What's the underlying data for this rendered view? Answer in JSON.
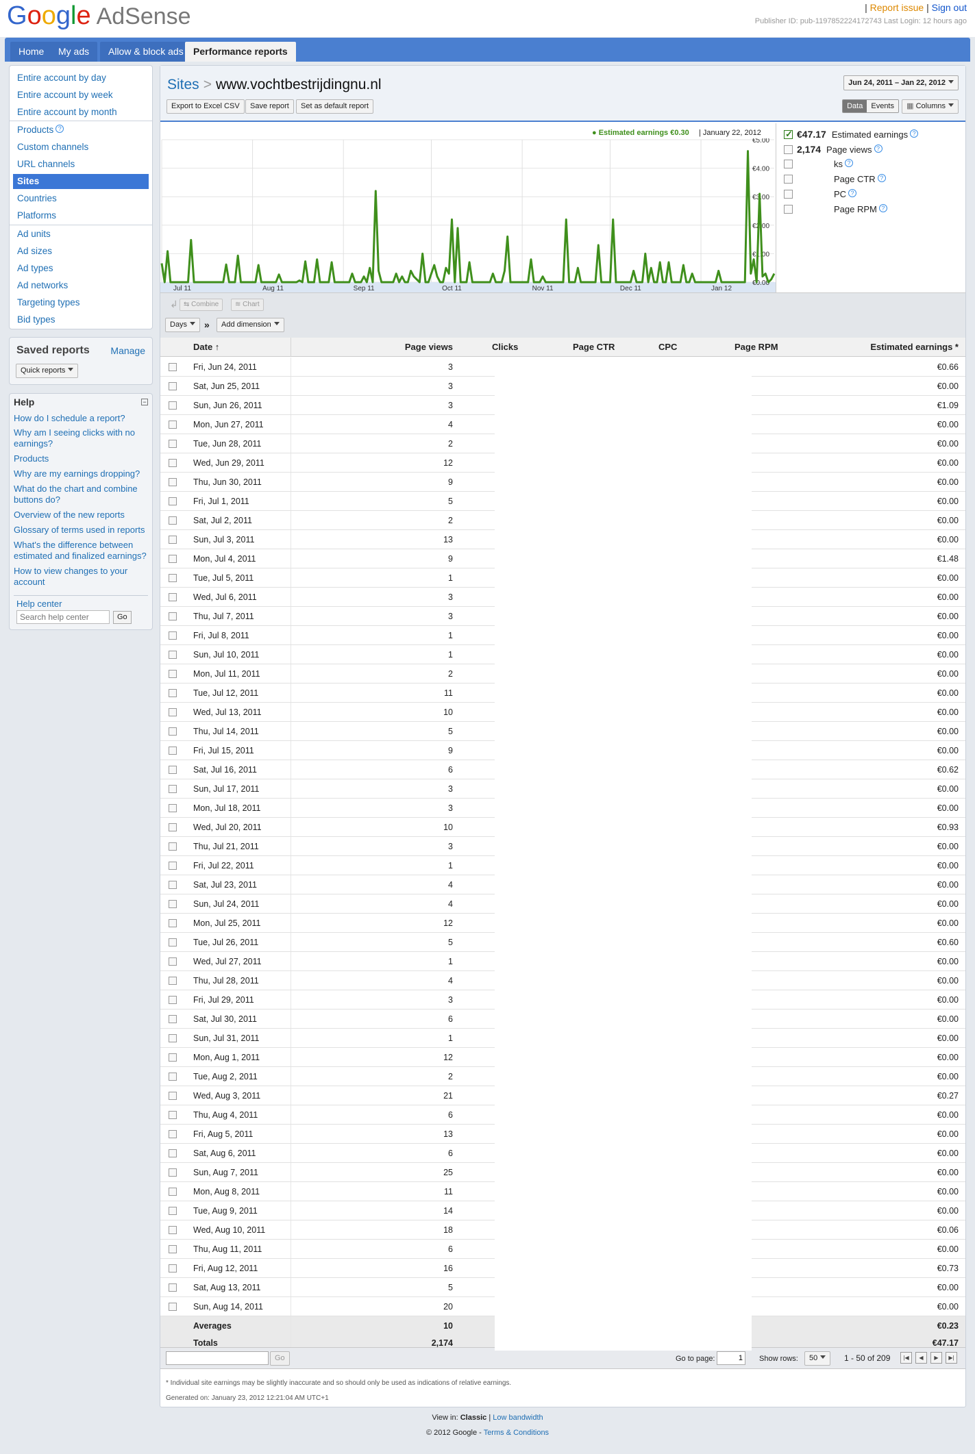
{
  "header": {
    "logo_letters": [
      "G",
      "o",
      "o",
      "g",
      "l",
      "e"
    ],
    "product": "AdSense",
    "report_issue": "Report issue",
    "sign_out": "Sign out",
    "publisher_info": "Publisher ID: pub-1197852224172743   Last Login: 12 hours ago"
  },
  "nav": [
    "Home",
    "My ads",
    "Allow & block ads",
    "Performance reports"
  ],
  "sidebar": {
    "items": [
      "Entire account by day",
      "Entire account by week",
      "Entire account by month",
      "Products",
      "Custom channels",
      "URL channels",
      "Sites",
      "Countries",
      "Platforms",
      "Ad units",
      "Ad sizes",
      "Ad types",
      "Ad networks",
      "Targeting types",
      "Bid types"
    ],
    "active_index": 6
  },
  "saved_reports": {
    "title": "Saved reports",
    "manage": "Manage",
    "quick": "Quick reports"
  },
  "help": {
    "title": "Help",
    "collapse": "−",
    "links": [
      "How do I schedule a report?",
      "Why am I seeing clicks with no earnings?",
      "Products",
      "Why are my earnings dropping?",
      "What do the chart and combine buttons do?",
      "Overview of the new reports",
      "Glossary of terms used in reports",
      "What's the difference between estimated and finalized earnings?",
      "How to view changes to your account"
    ],
    "help_center": "Help center",
    "search_placeholder": "Search help center",
    "go": "Go"
  },
  "report": {
    "crumb_parent": "Sites",
    "crumb_sep": ">",
    "crumb_current": "www.vochtbestrijdingnu.nl",
    "date_range": "Jun 24, 2011 – Jan 22, 2012",
    "btn_export": "Export to Excel CSV",
    "btn_save": "Save report",
    "btn_default": "Set as default report",
    "view_data": "Data",
    "view_events": "Events",
    "columns": "Columns",
    "combine": "Combine",
    "chart": "Chart",
    "days": "Days",
    "add_dimension": "Add dimension",
    "dim_sep": "»"
  },
  "metrics": [
    {
      "value": "€47.17",
      "label": "Estimated earnings",
      "checked": true
    },
    {
      "value": "2,174",
      "label": "Page views",
      "checked": false
    },
    {
      "value": "",
      "label": "ks",
      "checked": false
    },
    {
      "value": "",
      "label": "Page CTR",
      "checked": false
    },
    {
      "value": "",
      "label": "PC",
      "checked": false
    },
    {
      "value": "",
      "label": "Page RPM",
      "checked": false
    }
  ],
  "chart_data": {
    "type": "line",
    "tooltip_value": "● Estimated earnings €0.30",
    "tooltip_date": "January 22, 2012",
    "y_ticks": [
      "€5.00",
      "€4.00",
      "€3.00",
      "€2.00",
      "€1.00",
      "€0.00"
    ],
    "ylim": [
      0,
      5
    ],
    "x_ticks": [
      "Jul 11",
      "Aug 11",
      "Sep 11",
      "Oct 11",
      "Nov 11",
      "Dec 11",
      "Jan 12"
    ],
    "x_tick_days": [
      7,
      38,
      69,
      99,
      130,
      160,
      191
    ],
    "series_color": "#3f8f1c",
    "series": [
      {
        "values": [
          0.66,
          0,
          1.09,
          0,
          0,
          0,
          0,
          0,
          0,
          0,
          1.48,
          0,
          0,
          0,
          0,
          0,
          0,
          0,
          0,
          0,
          0,
          0,
          0.62,
          0,
          0,
          0,
          0.93,
          0,
          0,
          0,
          0,
          0,
          0,
          0.6,
          0,
          0,
          0,
          0,
          0,
          0,
          0.27,
          0,
          0,
          0,
          0,
          0,
          0,
          0.06,
          0,
          0.73,
          0,
          0,
          0,
          0.8,
          0,
          0,
          0,
          0,
          0.7,
          0,
          0,
          0,
          0,
          0,
          0,
          0.3,
          0,
          0,
          0,
          0.2,
          0,
          0.5,
          0,
          3.2,
          0.4,
          0,
          0,
          0,
          0,
          0,
          0.3,
          0,
          0.2,
          0,
          0,
          0.4,
          0.2,
          0.1,
          0,
          1.0,
          0,
          0,
          0.3,
          0.6,
          0.2,
          0,
          0,
          0.5,
          0.3,
          2.2,
          0,
          1.9,
          0,
          0,
          0,
          0.7,
          0,
          0,
          0,
          0,
          0,
          0,
          0,
          0.3,
          0,
          0,
          0,
          0.4,
          1.6,
          0,
          0,
          0,
          0,
          0,
          0,
          0,
          0.8,
          0,
          0,
          0,
          0.2,
          0,
          0,
          0,
          0,
          0,
          0,
          0,
          2.2,
          0,
          0,
          0,
          0.5,
          0,
          0,
          0,
          0,
          0,
          0,
          1.3,
          0,
          0,
          0,
          0,
          2.2,
          0,
          0,
          0,
          0,
          0,
          0,
          0.4,
          0,
          0,
          0,
          1.0,
          0,
          0.5,
          0,
          0,
          0.7,
          0,
          0,
          0.7,
          0,
          0,
          0,
          0,
          0.6,
          0,
          0,
          0.3,
          0,
          0,
          0,
          0,
          0,
          0,
          0,
          0,
          0.4,
          0,
          0,
          0,
          0,
          0,
          0,
          0,
          0,
          0,
          4.6,
          0.3,
          0.8,
          0,
          3.1,
          0.2,
          0.3,
          0,
          0.1,
          0.3
        ]
      }
    ]
  },
  "table": {
    "columns": [
      "Date ↑",
      "Page views",
      "Clicks",
      "Page CTR",
      "CPC",
      "Page RPM",
      "Estimated earnings *"
    ],
    "rows": [
      [
        "Fri, Jun 24, 2011",
        "3",
        "€0.66"
      ],
      [
        "Sat, Jun 25, 2011",
        "3",
        "€0.00"
      ],
      [
        "Sun, Jun 26, 2011",
        "3",
        "€1.09"
      ],
      [
        "Mon, Jun 27, 2011",
        "4",
        "€0.00"
      ],
      [
        "Tue, Jun 28, 2011",
        "2",
        "€0.00"
      ],
      [
        "Wed, Jun 29, 2011",
        "12",
        "€0.00"
      ],
      [
        "Thu, Jun 30, 2011",
        "9",
        "€0.00"
      ],
      [
        "Fri, Jul 1, 2011",
        "5",
        "€0.00"
      ],
      [
        "Sat, Jul 2, 2011",
        "2",
        "€0.00"
      ],
      [
        "Sun, Jul 3, 2011",
        "13",
        "€0.00"
      ],
      [
        "Mon, Jul 4, 2011",
        "9",
        "€1.48"
      ],
      [
        "Tue, Jul 5, 2011",
        "1",
        "€0.00"
      ],
      [
        "Wed, Jul 6, 2011",
        "3",
        "€0.00"
      ],
      [
        "Thu, Jul 7, 2011",
        "3",
        "€0.00"
      ],
      [
        "Fri, Jul 8, 2011",
        "1",
        "€0.00"
      ],
      [
        "Sun, Jul 10, 2011",
        "1",
        "€0.00"
      ],
      [
        "Mon, Jul 11, 2011",
        "2",
        "€0.00"
      ],
      [
        "Tue, Jul 12, 2011",
        "11",
        "€0.00"
      ],
      [
        "Wed, Jul 13, 2011",
        "10",
        "€0.00"
      ],
      [
        "Thu, Jul 14, 2011",
        "5",
        "€0.00"
      ],
      [
        "Fri, Jul 15, 2011",
        "9",
        "€0.00"
      ],
      [
        "Sat, Jul 16, 2011",
        "6",
        "€0.62"
      ],
      [
        "Sun, Jul 17, 2011",
        "3",
        "€0.00"
      ],
      [
        "Mon, Jul 18, 2011",
        "3",
        "€0.00"
      ],
      [
        "Wed, Jul 20, 2011",
        "10",
        "€0.93"
      ],
      [
        "Thu, Jul 21, 2011",
        "3",
        "€0.00"
      ],
      [
        "Fri, Jul 22, 2011",
        "1",
        "€0.00"
      ],
      [
        "Sat, Jul 23, 2011",
        "4",
        "€0.00"
      ],
      [
        "Sun, Jul 24, 2011",
        "4",
        "€0.00"
      ],
      [
        "Mon, Jul 25, 2011",
        "12",
        "€0.00"
      ],
      [
        "Tue, Jul 26, 2011",
        "5",
        "€0.60"
      ],
      [
        "Wed, Jul 27, 2011",
        "1",
        "€0.00"
      ],
      [
        "Thu, Jul 28, 2011",
        "4",
        "€0.00"
      ],
      [
        "Fri, Jul 29, 2011",
        "3",
        "€0.00"
      ],
      [
        "Sat, Jul 30, 2011",
        "6",
        "€0.00"
      ],
      [
        "Sun, Jul 31, 2011",
        "1",
        "€0.00"
      ],
      [
        "Mon, Aug 1, 2011",
        "12",
        "€0.00"
      ],
      [
        "Tue, Aug 2, 2011",
        "2",
        "€0.00"
      ],
      [
        "Wed, Aug 3, 2011",
        "21",
        "€0.27"
      ],
      [
        "Thu, Aug 4, 2011",
        "6",
        "€0.00"
      ],
      [
        "Fri, Aug 5, 2011",
        "13",
        "€0.00"
      ],
      [
        "Sat, Aug 6, 2011",
        "6",
        "€0.00"
      ],
      [
        "Sun, Aug 7, 2011",
        "25",
        "€0.00"
      ],
      [
        "Mon, Aug 8, 2011",
        "11",
        "€0.00"
      ],
      [
        "Tue, Aug 9, 2011",
        "14",
        "€0.00"
      ],
      [
        "Wed, Aug 10, 2011",
        "18",
        "€0.06"
      ],
      [
        "Thu, Aug 11, 2011",
        "6",
        "€0.00"
      ],
      [
        "Fri, Aug 12, 2011",
        "16",
        "€0.73"
      ],
      [
        "Sat, Aug 13, 2011",
        "5",
        "€0.00"
      ],
      [
        "Sun, Aug 14, 2011",
        "20",
        "€0.00"
      ]
    ],
    "averages": [
      "Averages",
      "10",
      "€0.23"
    ],
    "totals": [
      "Totals",
      "2,174",
      "€47.17"
    ]
  },
  "pager": {
    "go": "Go",
    "goto_label": "Go to page:",
    "goto_value": "1",
    "rows_label": "Show rows:",
    "rows_value": "50",
    "range": "1 - 50 of 209",
    "btn_first": "|◀",
    "btn_prev": "◀",
    "btn_next": "▶",
    "btn_last": "▶|"
  },
  "notes": {
    "disclaimer": "* Individual site earnings may be slightly inaccurate and so should only be used as indications of relative earnings.",
    "generated": "Generated on: January 23, 2012 12:21:04 AM UTC+1"
  },
  "footer": {
    "view_in": "View in:",
    "classic": "Classic",
    "sep": "|",
    "low_bandwidth": "Low bandwidth",
    "copyright": "© 2012 Google -",
    "terms": "Terms & Conditions"
  }
}
